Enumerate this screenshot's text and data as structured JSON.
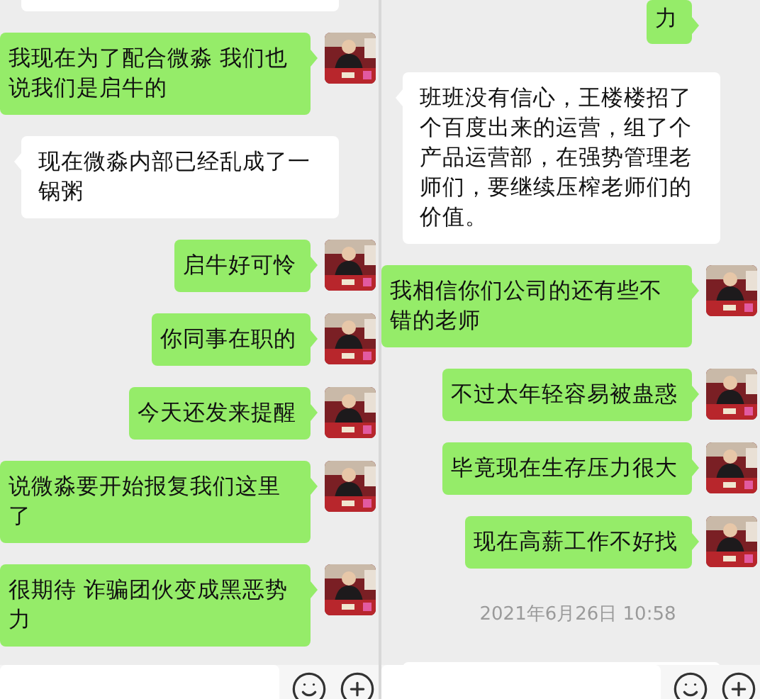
{
  "panels": [
    {
      "items": [
        {
          "kind": "cut_bubble",
          "sent": false
        },
        {
          "kind": "message",
          "sent": true,
          "text": "我现在为了配合微淼 我们也说我们是启牛的"
        },
        {
          "kind": "message",
          "sent": false,
          "text": "现在微淼内部已经乱成了一锅粥"
        },
        {
          "kind": "message",
          "sent": true,
          "text": "启牛好可怜"
        },
        {
          "kind": "message",
          "sent": true,
          "text": "你同事在职的"
        },
        {
          "kind": "message",
          "sent": true,
          "text": "今天还发来提醒"
        },
        {
          "kind": "message",
          "sent": true,
          "text": "说微淼要开始报复我们这里了"
        },
        {
          "kind": "message",
          "sent": true,
          "text": "很期待 诈骗团伙变成黑恶势力"
        }
      ]
    },
    {
      "items": [
        {
          "kind": "cut_message",
          "sent": true,
          "text": "力"
        },
        {
          "kind": "message",
          "sent": false,
          "text": "班班没有信心，王楼楼招了个百度出来的运营，组了个产品运营部，在强势管理老师们，要继续压榨老师们的价值。"
        },
        {
          "kind": "message",
          "sent": true,
          "text": "我相信你们公司的还有些不错的老师"
        },
        {
          "kind": "message",
          "sent": true,
          "text": "不过太年轻容易被蛊惑"
        },
        {
          "kind": "message",
          "sent": true,
          "text": "毕竟现在生存压力很大"
        },
        {
          "kind": "message",
          "sent": true,
          "text": "现在高薪工作不好找"
        },
        {
          "kind": "timestamp",
          "text": "2021年6月26日 10:58"
        },
        {
          "kind": "cut_bubble",
          "sent": false
        }
      ]
    }
  ]
}
